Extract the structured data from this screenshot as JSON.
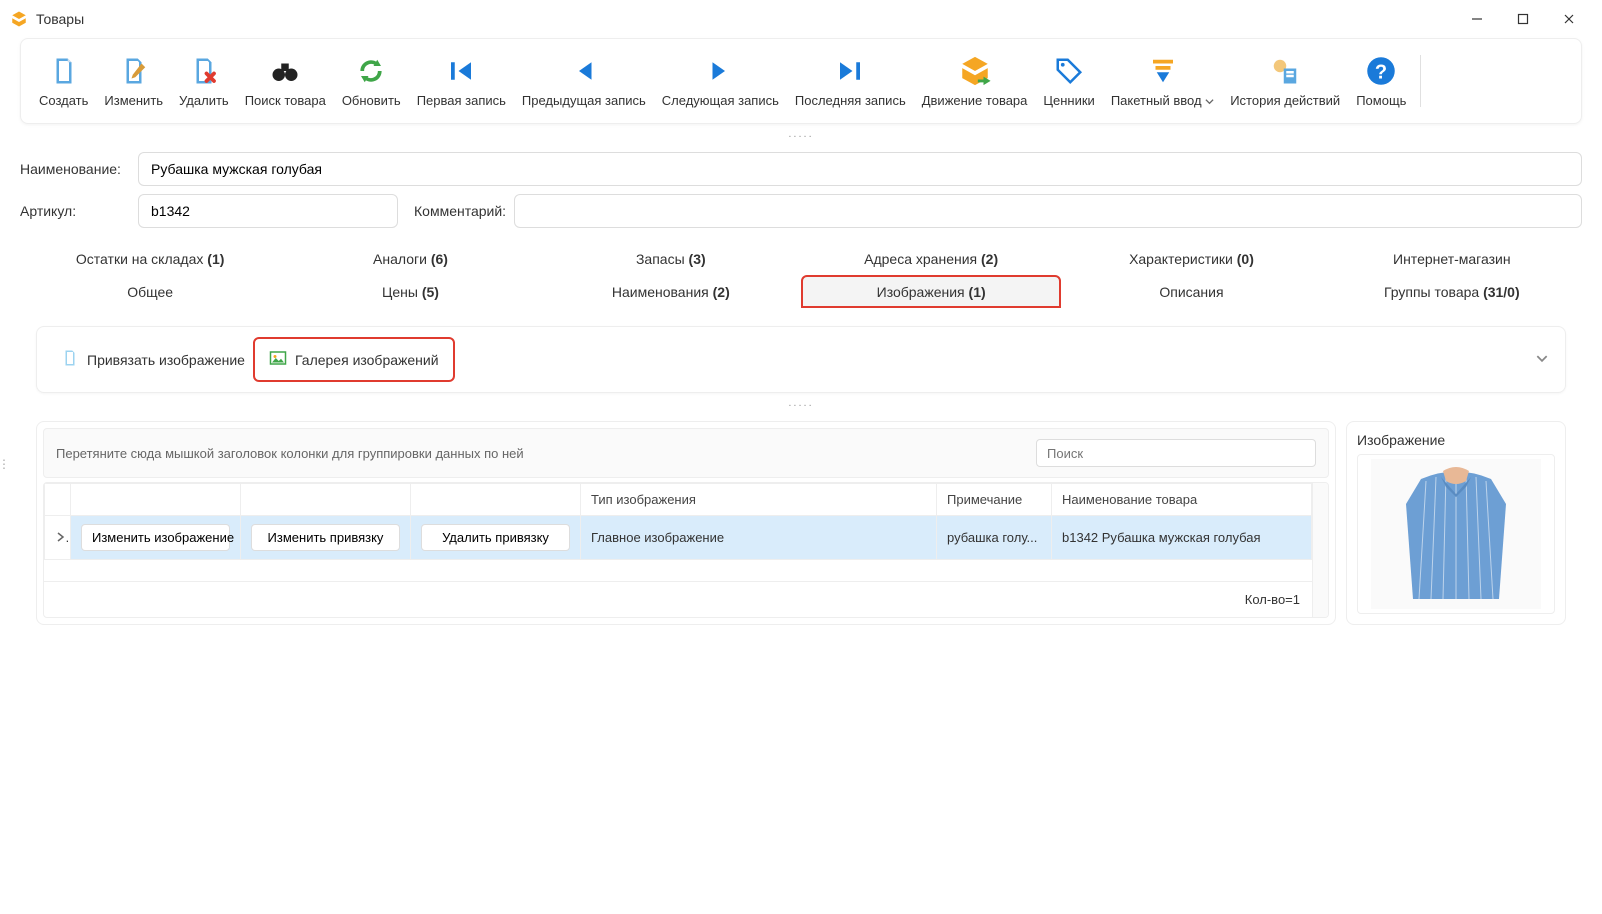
{
  "window": {
    "title": "Товары",
    "minimize": "—",
    "maximize": "☐",
    "close": "✕"
  },
  "toolbar": {
    "create": "Создать",
    "edit": "Изменить",
    "delete": "Удалить",
    "search": "Поиск товара",
    "refresh": "Обновить",
    "first": "Первая запись",
    "prev": "Предыдущая запись",
    "next": "Следующая запись",
    "last": "Последняя запись",
    "movement": "Движение товара",
    "pricetags": "Ценники",
    "batch": "Пакетный ввод",
    "history": "История действий",
    "help": "Помощь"
  },
  "form": {
    "name_label": "Наименование:",
    "name_value": "Рубашка мужская голубая",
    "article_label": "Артикул:",
    "article_value": "b1342",
    "comment_label": "Комментарий:",
    "comment_value": ""
  },
  "tabs_row1": [
    {
      "label": "Остатки на складах",
      "count": "(1)"
    },
    {
      "label": "Аналоги",
      "count": "(6)"
    },
    {
      "label": "Запасы",
      "count": "(3)"
    },
    {
      "label": "Адреса хранения",
      "count": "(2)"
    },
    {
      "label": "Характеристики",
      "count": "(0)"
    },
    {
      "label": "Интернет-магазин",
      "count": ""
    }
  ],
  "tabs_row2": [
    {
      "label": "Общее",
      "count": ""
    },
    {
      "label": "Цены",
      "count": "(5)"
    },
    {
      "label": "Наименования",
      "count": "(2)"
    },
    {
      "label": "Изображения",
      "count": "(1)",
      "active": true,
      "highlight": true
    },
    {
      "label": "Описания",
      "count": ""
    },
    {
      "label": "Группы товара",
      "count": "(31/0)"
    }
  ],
  "sub_toolbar": {
    "attach": "Привязать изображение",
    "gallery": "Галерея изображений"
  },
  "grid": {
    "group_hint": "Перетяните сюда мышкой заголовок колонки для группировки данных по ней",
    "search_placeholder": "Поиск",
    "columns": {
      "edit_image": "Изменить изображение",
      "edit_binding": "Изменить привязку",
      "delete_binding": "Удалить привязку",
      "type": "Тип изображения",
      "note": "Примечание",
      "product_name": "Наименование товара"
    },
    "rows": [
      {
        "type": "Главное изображение",
        "note": "рубашка голу...",
        "product_name": "b1342 Рубашка мужская голубая"
      }
    ],
    "footer": "Кол-во=1"
  },
  "image_panel": {
    "title": "Изображение"
  }
}
